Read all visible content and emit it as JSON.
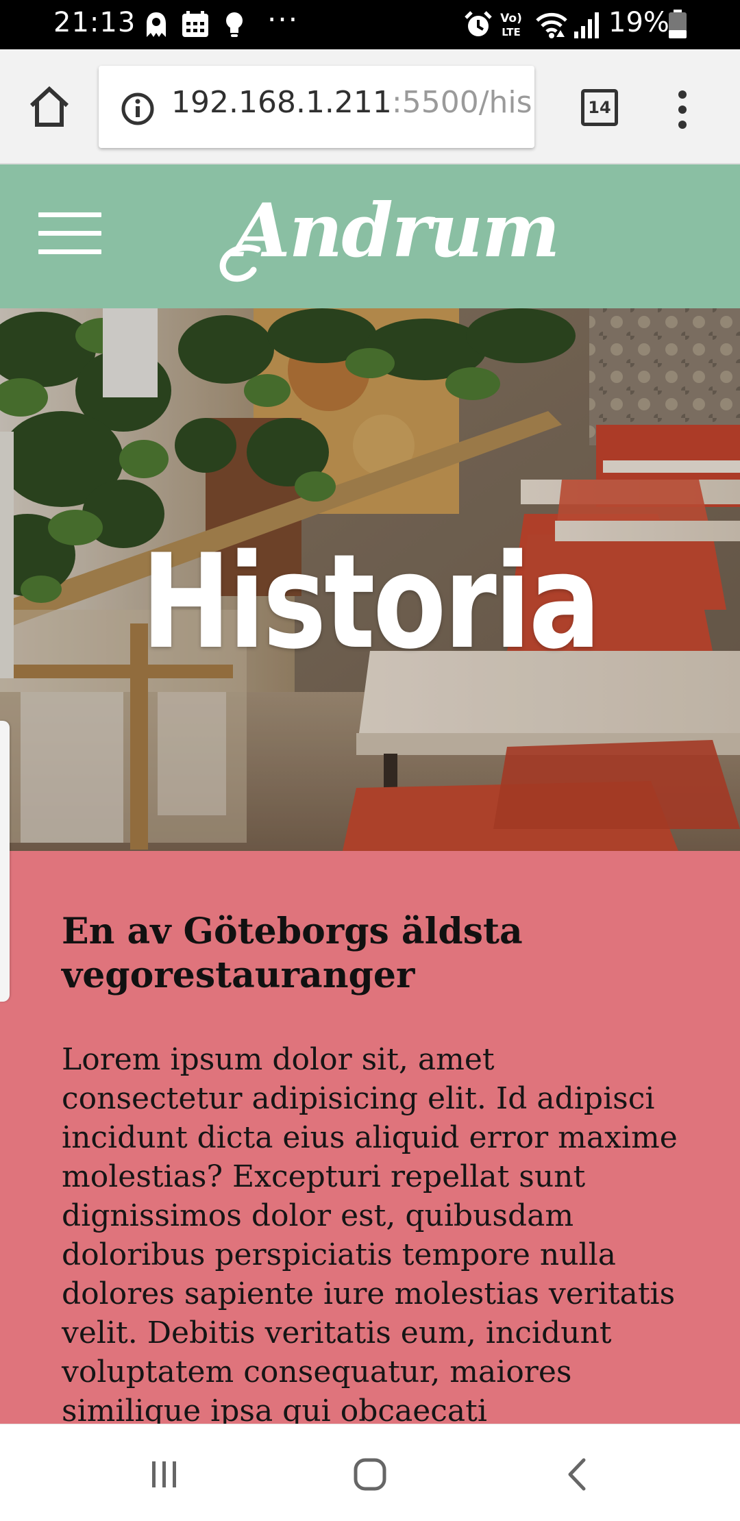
{
  "status_bar": {
    "time": "21:13",
    "notification_icons": [
      "pokemon-go-icon",
      "calendar-icon",
      "lightbulb-icon"
    ],
    "more_indicator": "···",
    "system_icons": [
      "alarm-icon",
      "volte-icon",
      "wifi-icon",
      "signal-icon",
      "battery-icon"
    ],
    "battery_percent": "19%"
  },
  "browser": {
    "home_icon": "home-icon",
    "security_icon": "info-icon",
    "url_host": "192.168.1.211",
    "url_path": ":5500/his",
    "tab_count": "14",
    "menu_icon": "vertical-dots-icon"
  },
  "site": {
    "header_color": "#8abfa3",
    "menu_icon": "hamburger-icon",
    "brand": "Andrum"
  },
  "hero": {
    "title": "Historia"
  },
  "content": {
    "background": "#df747c",
    "heading": "En av Göteborgs äldsta vegorestauranger",
    "body": "Lorem ipsum dolor sit, amet consectetur adipisicing elit. Id adipisci incidunt dicta eius aliquid error maxime molestias? Excepturi repellat sunt dignissimos dolor est, quibusdam doloribus perspiciatis tempore nulla dolores sapiente iure molestias veritatis velit. Debitis veritatis eum, incidunt voluptatem consequatur, maiores similique ipsa qui obcaecati"
  },
  "nav_bar": {
    "icons": [
      "recent-apps-icon",
      "home-circle-icon",
      "back-icon"
    ]
  }
}
